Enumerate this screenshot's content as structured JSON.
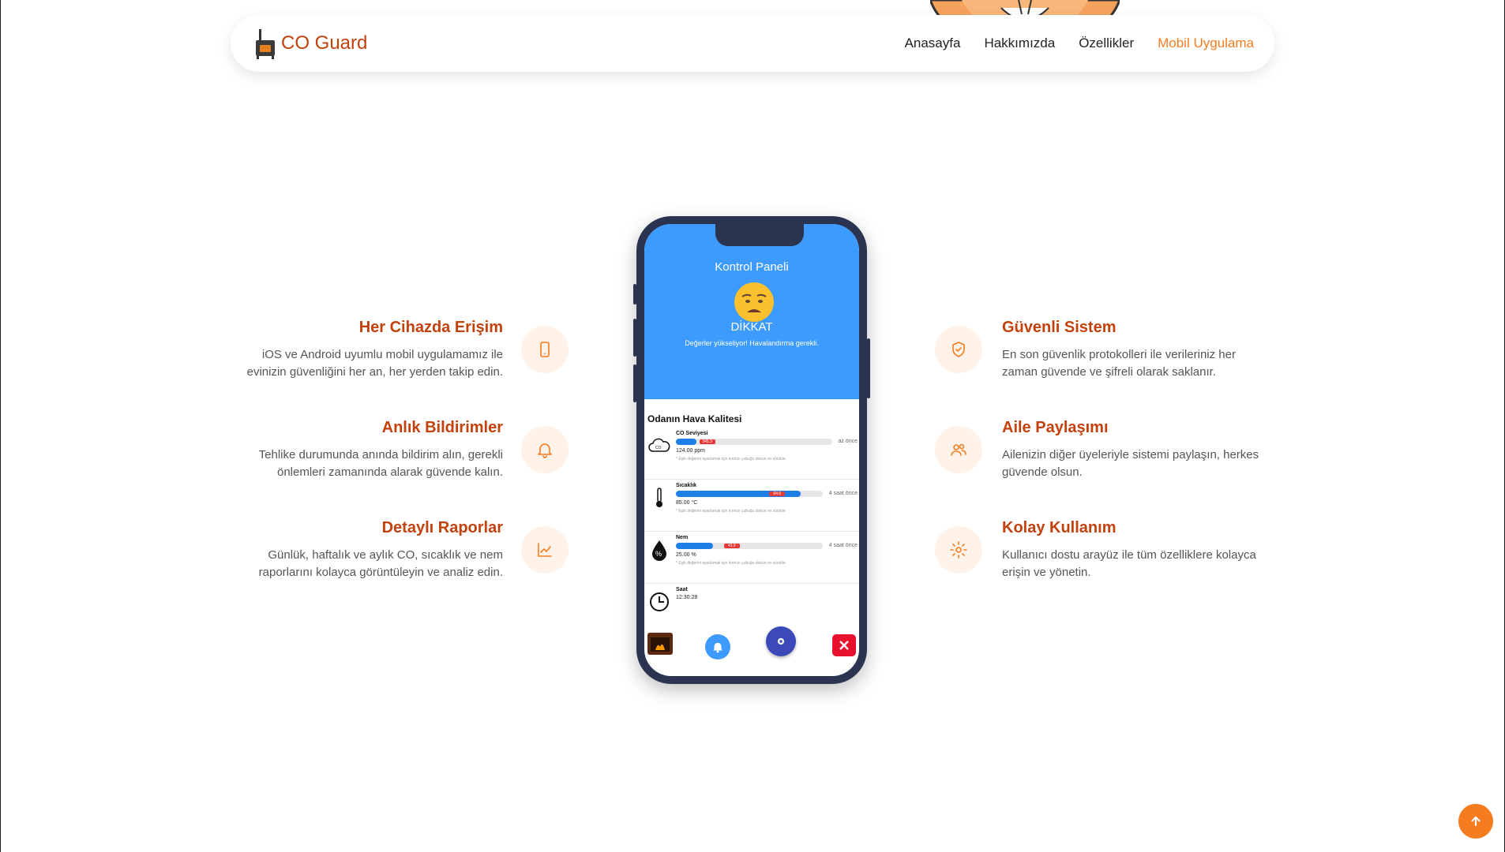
{
  "brand": {
    "name": "CO Guard"
  },
  "nav": {
    "items": [
      {
        "label": "Anasayfa",
        "active": false
      },
      {
        "label": "Hakkımızda",
        "active": false
      },
      {
        "label": "Özellikler",
        "active": false
      },
      {
        "label": "Mobil Uygulama",
        "active": true
      }
    ]
  },
  "features_left": [
    {
      "title": "Her Cihazda Erişim",
      "desc": "iOS ve Android uyumlu mobil uygulamamız ile evinizin güvenliğini her an, her yerden takip edin.",
      "icon": "smartphone-icon"
    },
    {
      "title": "Anlık Bildirimler",
      "desc": "Tehlike durumunda anında bildirim alın, gerekli önlemleri zamanında alarak güvende kalın.",
      "icon": "bell-icon"
    },
    {
      "title": "Detaylı Raporlar",
      "desc": "Günlük, haftalık ve aylık CO, sıcaklık ve nem raporlarını kolayca görüntüleyin ve analiz edin.",
      "icon": "chart-line-icon"
    }
  ],
  "features_right": [
    {
      "title": "Güvenli Sistem",
      "desc": "En son güvenlik protokolleri ile verileriniz her zaman güvende ve şifreli olarak saklanır.",
      "icon": "shield-check-icon"
    },
    {
      "title": "Aile Paylaşımı",
      "desc": "Ailenizin diğer üyeleriyle sistemi paylaşın, herkes güvende olsun.",
      "icon": "users-icon"
    },
    {
      "title": "Kolay Kullanım",
      "desc": "Kullanıcı dostu arayüz ile tüm özelliklere kolayca erişin ve yönetin.",
      "icon": "gear-icon"
    }
  ],
  "phone": {
    "panel_title": "Kontrol Paneli",
    "status_title": "DİKKAT",
    "status_desc": "Değerler yükseliyor! Havalandırma gerekli.",
    "quality_title": "Odanın Hava Kalitesi",
    "metrics": [
      {
        "label": "CO Seviyesi",
        "value": "124.00 ppm",
        "time": "az önce",
        "marker": "345.3",
        "fill": 0.13,
        "marker_pos": 0.2,
        "hint": "* Eşik değerini ayarlamak için kırmızı çubuğu dokun ve sürükle"
      },
      {
        "label": "Sıcaklık",
        "value": "85.00 °C",
        "time": "4 saat önce",
        "marker": "64.6",
        "fill": 0.85,
        "marker_pos": 0.69,
        "hint": "* Eşik değerini ayarlamak için kırmızı çubuğu dokun ve sürükle"
      },
      {
        "label": "Nem",
        "value": "25.00 %",
        "time": "4 saat önce",
        "marker": "45.9",
        "fill": 0.25,
        "marker_pos": 0.38,
        "hint": "* Eşik değerini ayarlamak için kırmızı çubuğu dokun ve sürükle"
      },
      {
        "label": "Saat",
        "value": "12:30:28"
      }
    ]
  },
  "colors": {
    "accent": "#f57c1f",
    "title": "#c2410c",
    "phone_blue": "#3d9bff"
  }
}
